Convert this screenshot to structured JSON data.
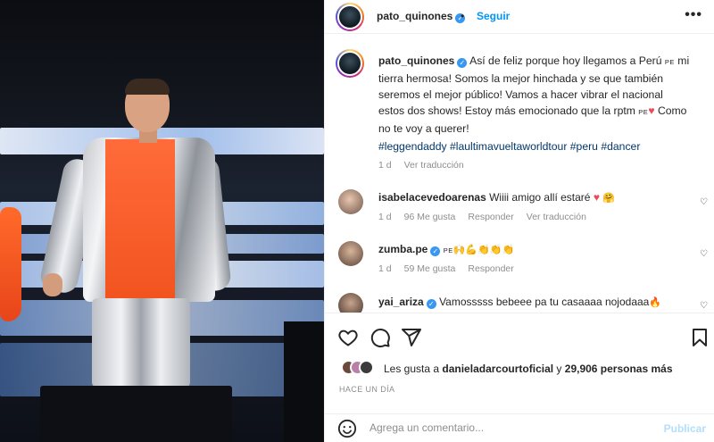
{
  "post": {
    "username": "pato_quinones",
    "follow_label": "Seguir",
    "separator": "•",
    "more_label": "•••"
  },
  "caption": {
    "username": "pato_quinones",
    "text_part1": "Así de feliz porque hoy llegamos a Perú ",
    "flag1": "PE",
    "text_part2": " mi tierra hermosa! Somos la mejor hinchada y se que también seremos el mejor público! Vamos a hacer vibrar el nacional estos dos shows! Estoy más emocionado que la rptm ",
    "flag2": "PE",
    "text_part3": " Como no te voy a querer!",
    "hashtags": "#leggendaddy #laultimavueltaworldtour #peru #dancer",
    "age": "1 d",
    "translate": "Ver traducción"
  },
  "comments": [
    {
      "username": "isabelacevedoarenas",
      "text": "Wiiii amigo allí estaré",
      "age": "1 d",
      "likes": "96 Me gusta",
      "reply": "Responder",
      "translate": "Ver traducción"
    },
    {
      "username": "zumba.pe",
      "flag": "PE",
      "age": "1 d",
      "likes": "59 Me gusta",
      "reply": "Responder"
    },
    {
      "username": "yai_ariza",
      "text": "Vamosssss bebeee pa tu casaaaa nojodaaa"
    }
  ],
  "likes_line": {
    "prefix": "Les gusta a ",
    "user": "danieladarcourtoficial",
    "middle": " y ",
    "count": "29,906 personas más"
  },
  "timestamp": "HACE UN DÍA",
  "add_comment": {
    "placeholder": "Agrega un comentario...",
    "publish_label": "Publicar"
  },
  "colors": {
    "link_blue": "#0095f6",
    "hashtag_blue": "#00376b",
    "muted": "#8e8e8e",
    "verified": "#3897f0",
    "heart_red": "#ed4956"
  },
  "icons": [
    "heart-icon",
    "comment-icon",
    "share-icon",
    "bookmark-icon",
    "emoji-icon",
    "more-options-icon",
    "verified-icon"
  ]
}
